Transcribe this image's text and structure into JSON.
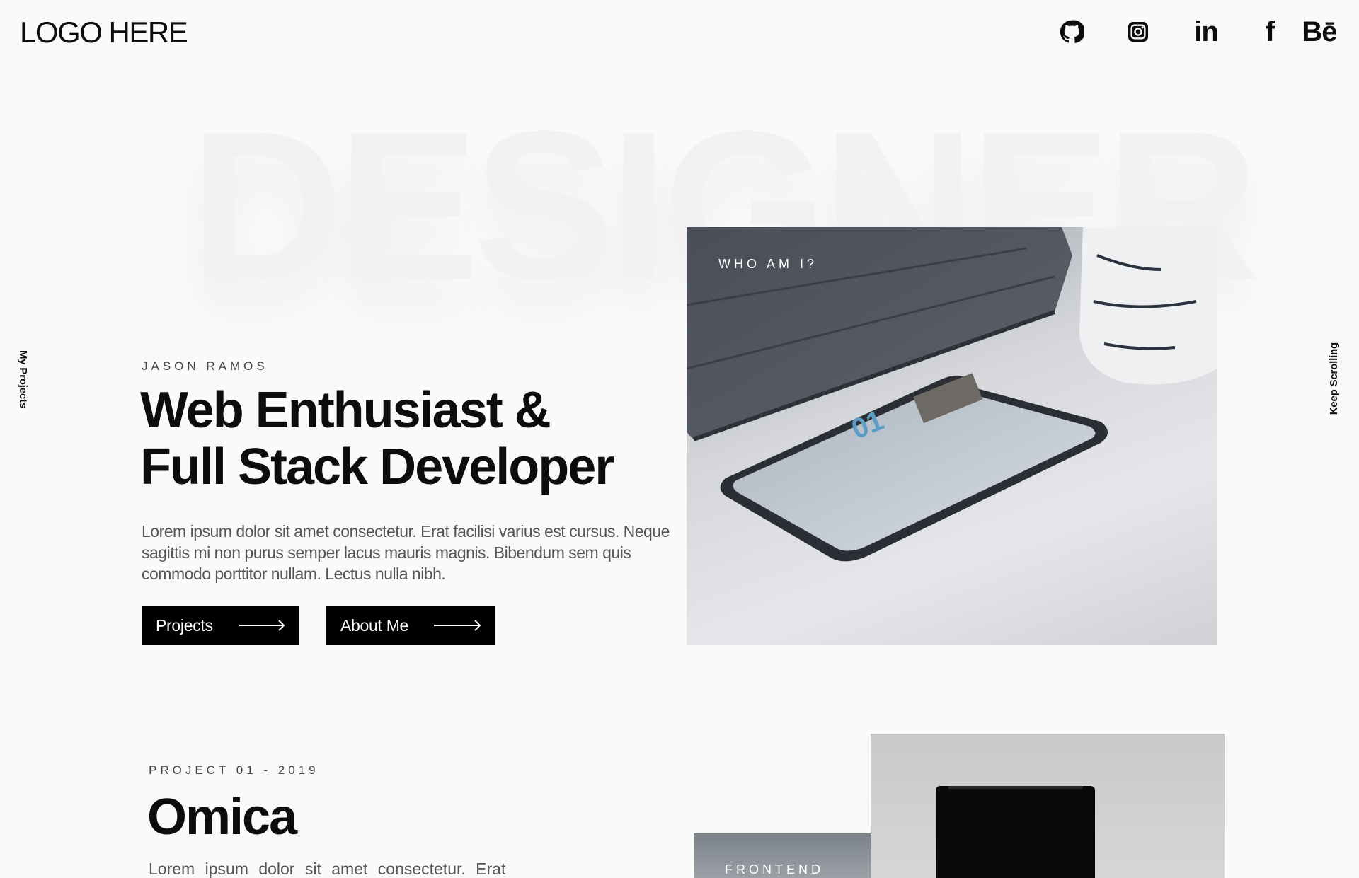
{
  "header": {
    "logo": "LOGO HERE",
    "socials": [
      {
        "name": "github",
        "icon": "github-icon"
      },
      {
        "name": "instagram",
        "icon": "instagram-icon"
      },
      {
        "name": "linkedin",
        "icon": "linkedin-icon",
        "text": "in"
      },
      {
        "name": "facebook",
        "icon": "facebook-icon",
        "text": "f"
      },
      {
        "name": "behance",
        "icon": "behance-icon",
        "text": "Bē"
      }
    ]
  },
  "side": {
    "left": "My Projects",
    "right": "Keep Scrolling"
  },
  "hero": {
    "background_word": "DESIGNER",
    "eyebrow": "JASON RAMOS",
    "title_line1": "Web Enthusiast &",
    "title_line2": "Full Stack Developer",
    "text": "Lorem ipsum dolor sit amet consectetur. Erat facilisi varius est cursus. Neque sagittis mi non purus semper lacus mauris magnis. Bibendum sem quis commodo porttitor nullam. Lectus nulla nibh.",
    "buttons": {
      "projects": "Projects",
      "about": "About Me"
    },
    "image_label": "WHO AM I?"
  },
  "project": {
    "eyebrow": "PROJECT 01 - 2019",
    "title": "Omica",
    "text": "Lorem ipsum dolor sit amet consectetur. Erat",
    "card_label": "FRONTEND"
  },
  "colors": {
    "background": "#fafafa",
    "text": "#0d0d0d",
    "muted": "#555555",
    "button": "#000000"
  }
}
